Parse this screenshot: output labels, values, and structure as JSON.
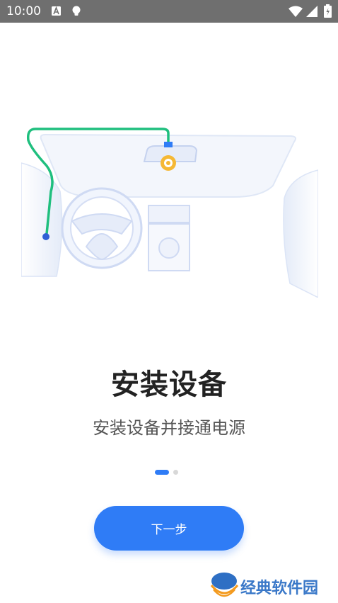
{
  "status_bar": {
    "time": "10:00",
    "icons": [
      "a-icon",
      "bulb-icon",
      "wifi-icon",
      "signal-icon",
      "battery-icon"
    ]
  },
  "illustration": {
    "icon": "car-dashboard-installation-illustration",
    "colors": {
      "cable": "#1fbf7e",
      "camera": "#f5b835",
      "line": "#c9d6f2",
      "fill": "#eef2fb"
    }
  },
  "onboarding": {
    "title": "安装设备",
    "subtitle": "安装设备并接通电源",
    "page_indicator": {
      "current_page": 1,
      "total_pages": 2
    }
  },
  "actions": {
    "next_label": "下一步"
  },
  "watermark": {
    "text": "经典软件园"
  },
  "colors": {
    "accent": "#2f7cf6",
    "status_bar_bg": "#6f6f6f",
    "title_text": "#222222",
    "subtitle_text": "#555555"
  }
}
